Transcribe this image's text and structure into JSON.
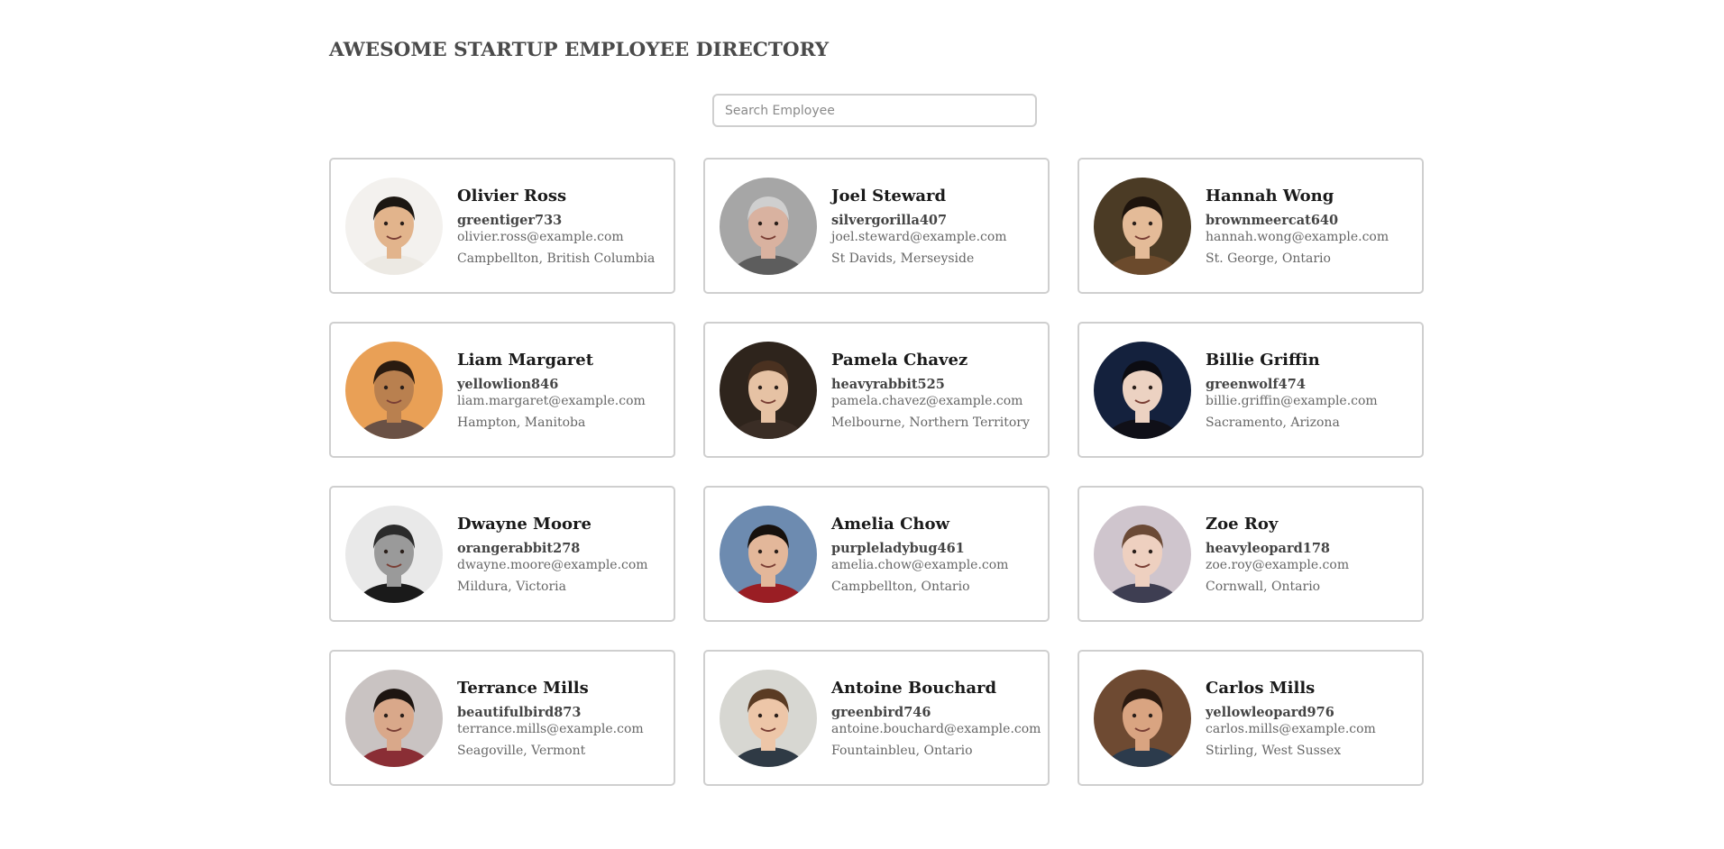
{
  "header": {
    "title": "AWESOME STARTUP EMPLOYEE DIRECTORY"
  },
  "search": {
    "placeholder": "Search Employee",
    "value": ""
  },
  "employees": [
    {
      "name": "Olivier Ross",
      "username": "greentiger733",
      "email": "olivier.ross@example.com",
      "location": "Campbellton, British Columbia",
      "avatar": {
        "bg": "#f3f1ee",
        "skin": "#e2b48c",
        "hair": "#1c1712",
        "shirt": "#ece9e3"
      }
    },
    {
      "name": "Joel Steward",
      "username": "silvergorilla407",
      "email": "joel.steward@example.com",
      "location": "St Davids, Merseyside",
      "avatar": {
        "bg": "#a6a6a6",
        "skin": "#d9b2a0",
        "hair": "#cfcfcf",
        "shirt": "#5d5d5d"
      }
    },
    {
      "name": "Hannah Wong",
      "username": "brownmeercat640",
      "email": "hannah.wong@example.com",
      "location": "St. George, Ontario",
      "avatar": {
        "bg": "#4b3b25",
        "skin": "#e4bb98",
        "hair": "#1e140d",
        "shirt": "#6b4a2c"
      }
    },
    {
      "name": "Liam Margaret",
      "username": "yellowlion846",
      "email": "liam.margaret@example.com",
      "location": "Hampton, Manitoba",
      "avatar": {
        "bg": "#e9a056",
        "skin": "#b9804f",
        "hair": "#2a1b10",
        "shirt": "#6a5145"
      }
    },
    {
      "name": "Pamela Chavez",
      "username": "heavyrabbit525",
      "email": "pamela.chavez@example.com",
      "location": "Melbourne, Northern Territory",
      "avatar": {
        "bg": "#2e241c",
        "skin": "#e6c2a4",
        "hair": "#4a3120",
        "shirt": "#3a2d25"
      }
    },
    {
      "name": "Billie Griffin",
      "username": "greenwolf474",
      "email": "billie.griffin@example.com",
      "location": "Sacramento, Arizona",
      "avatar": {
        "bg": "#14213d",
        "skin": "#ecd2c2",
        "hair": "#0c0c12",
        "shirt": "#101018"
      }
    },
    {
      "name": "Dwayne Moore",
      "username": "orangerabbit278",
      "email": "dwayne.moore@example.com",
      "location": "Mildura, Victoria",
      "avatar": {
        "bg": "#e9e9e9",
        "skin": "#9a9a9a",
        "hair": "#2b2b2b",
        "shirt": "#1a1a1a"
      }
    },
    {
      "name": "Amelia Chow",
      "username": "purpleladybug461",
      "email": "amelia.chow@example.com",
      "location": "Campbellton, Ontario",
      "avatar": {
        "bg": "#6d8bb0",
        "skin": "#e3b79a",
        "hair": "#17110d",
        "shirt": "#9a1e24"
      }
    },
    {
      "name": "Zoe Roy",
      "username": "heavyleopard178",
      "email": "zoe.roy@example.com",
      "location": "Cornwall, Ontario",
      "avatar": {
        "bg": "#cfc5cd",
        "skin": "#eed0c0",
        "hair": "#6b4a36",
        "shirt": "#3e3e52"
      }
    },
    {
      "name": "Terrance Mills",
      "username": "beautifulbird873",
      "email": "terrance.mills@example.com",
      "location": "Seagoville, Vermont",
      "avatar": {
        "bg": "#c9c3c2",
        "skin": "#d9a88a",
        "hair": "#1d1511",
        "shirt": "#8a2e35"
      }
    },
    {
      "name": "Antoine Bouchard",
      "username": "greenbird746",
      "email": "antoine.bouchard@example.com",
      "location": "Fountainbleu, Ontario",
      "avatar": {
        "bg": "#d7d7d2",
        "skin": "#edc6a8",
        "hair": "#5a3b23",
        "shirt": "#2f3a45"
      }
    },
    {
      "name": "Carlos Mills",
      "username": "yellowleopard976",
      "email": "carlos.mills@example.com",
      "location": "Stirling, West Sussex",
      "avatar": {
        "bg": "#6e4a32",
        "skin": "#d9a481",
        "hair": "#2b1a10",
        "shirt": "#2c3b4c"
      }
    }
  ]
}
